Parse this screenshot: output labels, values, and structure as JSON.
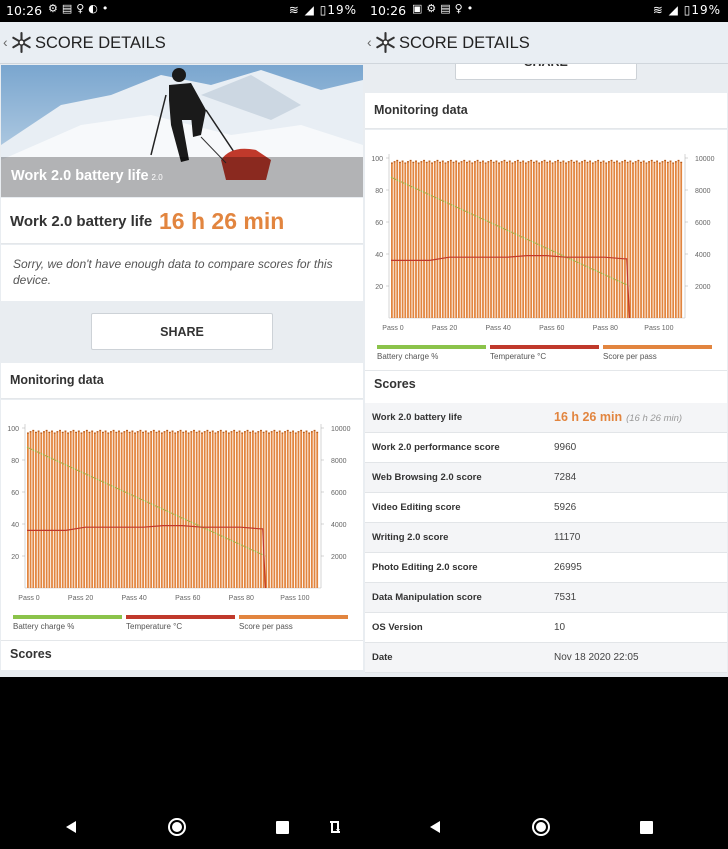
{
  "status_left": {
    "time": "10:26",
    "battery": "19%"
  },
  "status_right": {
    "time": "10:26",
    "battery": "19%"
  },
  "appbar": {
    "title": "SCORE DETAILS"
  },
  "hero": {
    "title": "Work 2.0 battery life",
    "version": "2.0"
  },
  "battery_life": {
    "label": "Work 2.0 battery life",
    "value": "16 h 26 min"
  },
  "sorry_text": "Sorry, we don't have enough data to compare scores for this device.",
  "share_label": "SHARE",
  "monitoring_label": "Monitoring data",
  "scores_label": "Scores",
  "legend": [
    "Battery charge %",
    "Temperature °C",
    "Score per pass"
  ],
  "colors": {
    "accent": "#e2853f",
    "battery": "#8bc34a",
    "temperature": "#c0392b",
    "score": "#e2853f"
  },
  "chart_data": {
    "type": "bar",
    "x_ticks": [
      "Pass 0",
      "Pass 20",
      "Pass 40",
      "Pass 60",
      "Pass 80",
      "Pass 100"
    ],
    "y_left_ticks": [
      "100",
      "80",
      "60",
      "40",
      "20"
    ],
    "y_right_ticks": [
      "10000",
      "8000",
      "6000",
      "4000",
      "2000"
    ],
    "ylim_left": [
      0,
      100
    ],
    "ylim_right": [
      0,
      10000
    ],
    "passes": 109,
    "score_per_pass_approx": 9800,
    "battery_start": 88,
    "battery_end": 20,
    "battery_cutoff_pass": 89,
    "temperature_values": [
      36,
      36,
      36,
      38,
      38,
      38,
      38,
      39,
      39,
      38,
      38,
      38,
      37
    ]
  },
  "scores_table": [
    {
      "key": "Work 2.0 battery life",
      "value": "16 h 26 min",
      "value2": "(16 h 26 min)"
    },
    {
      "key": "Work 2.0 performance score",
      "value": "9960"
    },
    {
      "key": "Web Browsing 2.0 score",
      "value": "7284"
    },
    {
      "key": "Video Editing score",
      "value": "5926"
    },
    {
      "key": "Writing 2.0 score",
      "value": "11170"
    },
    {
      "key": "Photo Editing 2.0 score",
      "value": "26995"
    },
    {
      "key": "Data Manipulation score",
      "value": "7531"
    },
    {
      "key": "OS Version",
      "value": "10"
    },
    {
      "key": "Date",
      "value": "Nov 18 2020 22:05"
    }
  ]
}
